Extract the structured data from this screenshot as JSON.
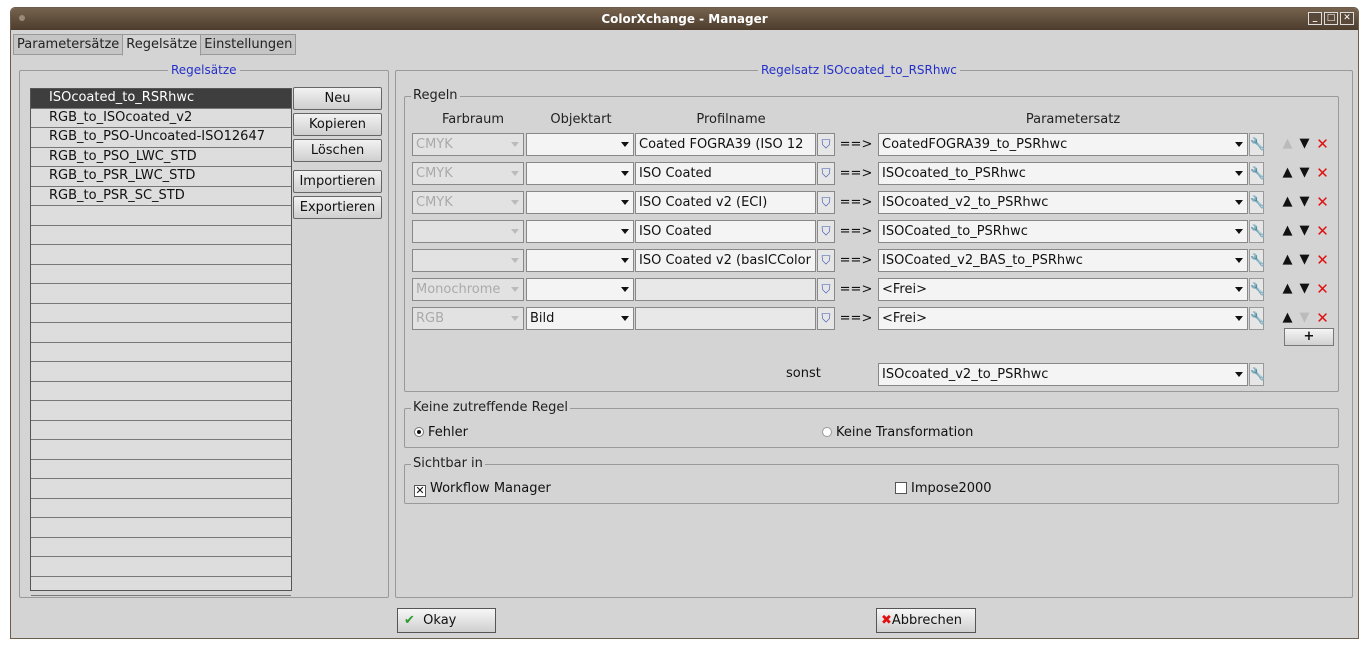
{
  "window": {
    "title": "ColorXchange - Manager",
    "controls": [
      "minimize",
      "maximize",
      "close"
    ]
  },
  "tabs": [
    {
      "label": "Parametersätze"
    },
    {
      "label": "Regelsätze",
      "active": true
    },
    {
      "label": "Einstellungen"
    }
  ],
  "left": {
    "title": "Regelsätze",
    "items": [
      "ISOcoated_to_RSRhwc",
      "RGB_to_ISOcoated_v2",
      "RGB_to_PSO-Uncoated-ISO12647",
      "RGB_to_PSO_LWC_STD",
      "RGB_to_PSR_LWC_STD",
      "RGB_to_PSR_SC_STD"
    ],
    "selected_index": 0,
    "buttons": {
      "neu": "Neu",
      "kopieren": "Kopieren",
      "loeschen": "Löschen",
      "importieren": "Importieren",
      "exportieren": "Exportieren"
    }
  },
  "right": {
    "title": "Regelsatz ISOcoated_to_RSRhwc",
    "rules": {
      "legend": "Regeln",
      "headers": {
        "farbraum": "Farbraum",
        "objektart": "Objektart",
        "profilname": "Profilname",
        "parametersatz": "Parametersatz"
      },
      "arrow": "==>",
      "rows": [
        {
          "farbraum": "CMYK",
          "objektart": "",
          "profil": "Coated FOGRA39 (ISO 12",
          "param": "CoatedFOGRA39_to_PSRhwc",
          "wrench": false
        },
        {
          "farbraum": "CMYK",
          "objektart": "",
          "profil": "ISO Coated",
          "param": "ISOcoated_to_PSRhwc",
          "wrench": false
        },
        {
          "farbraum": "CMYK",
          "objektart": "",
          "profil": "ISO Coated v2 (ECI)",
          "param": "ISOcoated_v2_to_PSRhwc",
          "wrench": false
        },
        {
          "farbraum": "",
          "objektart": "",
          "profil": "ISO Coated",
          "param": "ISOCoated_to_PSRhwc",
          "wrench": false
        },
        {
          "farbraum": "",
          "objektart": "",
          "profil": "ISO Coated v2 (basICColor",
          "param": "ISOCoated_v2_BAS_to_PSRhwc",
          "wrench": false
        },
        {
          "farbraum": "Monochrome",
          "objektart": "",
          "profil": "",
          "param": "<Frei>",
          "wrench": true
        },
        {
          "farbraum": "RGB",
          "objektart": "Bild",
          "profil": "",
          "param": "<Frei>",
          "wrench": true
        }
      ],
      "add_label": "+",
      "sonst_label": "sonst",
      "sonst_value": "ISOcoated_v2_to_PSRhwc"
    },
    "keine": {
      "legend": "Keine zutreffende Regel",
      "opt1": "Fehler",
      "opt2": "Keine Transformation",
      "selected": "Fehler"
    },
    "sichtbar": {
      "legend": "Sichtbar in",
      "opt1": "Workflow Manager",
      "opt1_checked": true,
      "opt2": "Impose2000",
      "opt2_checked": false
    }
  },
  "footer": {
    "okay": "Okay",
    "abbrechen": "Abbrechen"
  }
}
